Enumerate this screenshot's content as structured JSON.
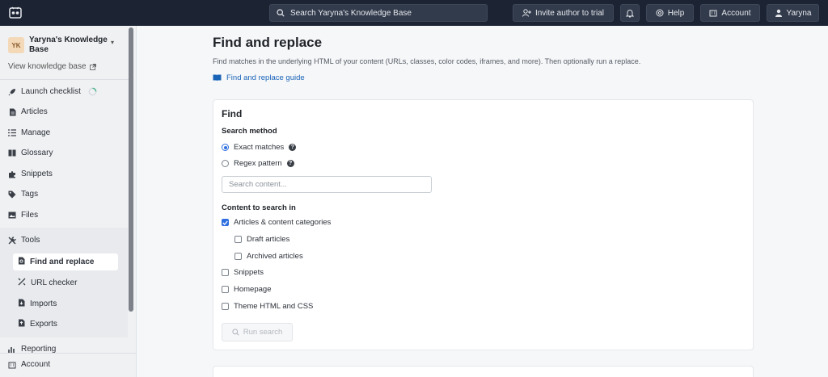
{
  "topbar": {
    "search_text": "Search Yaryna's Knowledge Base",
    "invite_label": "Invite author to trial",
    "help_label": "Help",
    "account_label": "Account",
    "user_label": "Yaryna"
  },
  "sidebar": {
    "avatar_initials": "YK",
    "kb_name": "Yaryna's Knowledge Base",
    "view_kb": "View knowledge base",
    "items": [
      {
        "label": "Launch checklist",
        "icon": "rocket-icon"
      },
      {
        "label": "Articles",
        "icon": "document-icon"
      },
      {
        "label": "Manage",
        "icon": "list-icon"
      },
      {
        "label": "Glossary",
        "icon": "book-icon"
      },
      {
        "label": "Snippets",
        "icon": "puzzle-icon"
      },
      {
        "label": "Tags",
        "icon": "tag-icon"
      },
      {
        "label": "Files",
        "icon": "image-icon"
      },
      {
        "label": "Tools",
        "icon": "tools-icon"
      }
    ],
    "tools_items": [
      {
        "label": "Find and replace",
        "icon": "find-replace-icon",
        "active": true
      },
      {
        "label": "URL checker",
        "icon": "link-icon"
      },
      {
        "label": "Imports",
        "icon": "import-icon"
      },
      {
        "label": "Exports",
        "icon": "export-icon"
      }
    ],
    "reporting_label": "Reporting",
    "account_label": "Account"
  },
  "main": {
    "title": "Find and replace",
    "description": "Find matches in the underlying HTML of your content (URLs, classes, color codes, iframes, and more). Then optionally run a replace.",
    "guide_link": "Find and replace guide"
  },
  "find": {
    "heading": "Find",
    "search_method_label": "Search method",
    "exact_label": "Exact matches",
    "regex_label": "Regex pattern",
    "search_placeholder": "Search content...",
    "content_label": "Content to search in",
    "articles_label": "Articles & content categories",
    "draft_label": "Draft articles",
    "archived_label": "Archived articles",
    "snippets_label": "Snippets",
    "homepage_label": "Homepage",
    "theme_label": "Theme HTML and CSS",
    "run_label": "Run search"
  },
  "colors": {
    "topbar": "#1c2434",
    "accent": "#2f6fe0",
    "link": "#1a64b8"
  }
}
